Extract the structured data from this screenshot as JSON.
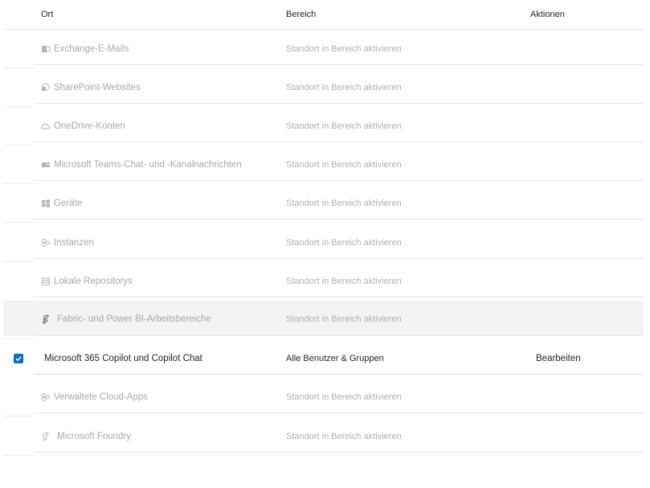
{
  "columns": {
    "location": "Ort",
    "scope": "Bereich",
    "actions": "Aktionen"
  },
  "rows": [
    {
      "icon": "exchange-icon",
      "label": "Exchange-E-Mails",
      "scope": "Standort in Bereich aktivieren",
      "action": ""
    },
    {
      "icon": "sharepoint-icon",
      "label": "SharePoint-Websites",
      "scope": "Standort in Bereich aktivieren",
      "action": ""
    },
    {
      "icon": "onedrive-icon",
      "label": "OneDrive-Konten",
      "scope": "Standort in Bereich aktivieren",
      "action": ""
    },
    {
      "icon": "teams-icon",
      "label": "Microsoft Teams-Chat- und -Kanalnachrichten",
      "scope": "Standort in Bereich aktivieren",
      "action": ""
    },
    {
      "icon": "windows-devices-icon",
      "label": "Geräte",
      "scope": "Standort in Bereich aktivieren",
      "action": ""
    },
    {
      "icon": "instances-icon",
      "label": "Instanzen",
      "scope": "Standort in Bereich aktivieren",
      "action": ""
    },
    {
      "icon": "repository-icon",
      "label": "Lokale Repositorys",
      "scope": "Standort in Bereich aktivieren",
      "action": ""
    },
    {
      "icon": "fabric-icon",
      "label": "Fabric- und Power BI-Arbeitsbereiche",
      "scope": "Standort in Bereich aktivieren",
      "action": ""
    },
    {
      "icon": "",
      "label": "Microsoft 365 Copilot und Copilot Chat",
      "scope": "Alle Benutzer & Gruppen",
      "action": "Bearbeiten",
      "checked": true
    },
    {
      "icon": "cloud-apps-icon",
      "label": "Verwaltete Cloud-Apps",
      "scope": "Standort in Bereich aktivieren",
      "action": ""
    },
    {
      "icon": "foundry-icon",
      "label": "Microsoft Foundry",
      "scope": "Standort in Bereich aktivieren",
      "action": ""
    }
  ]
}
